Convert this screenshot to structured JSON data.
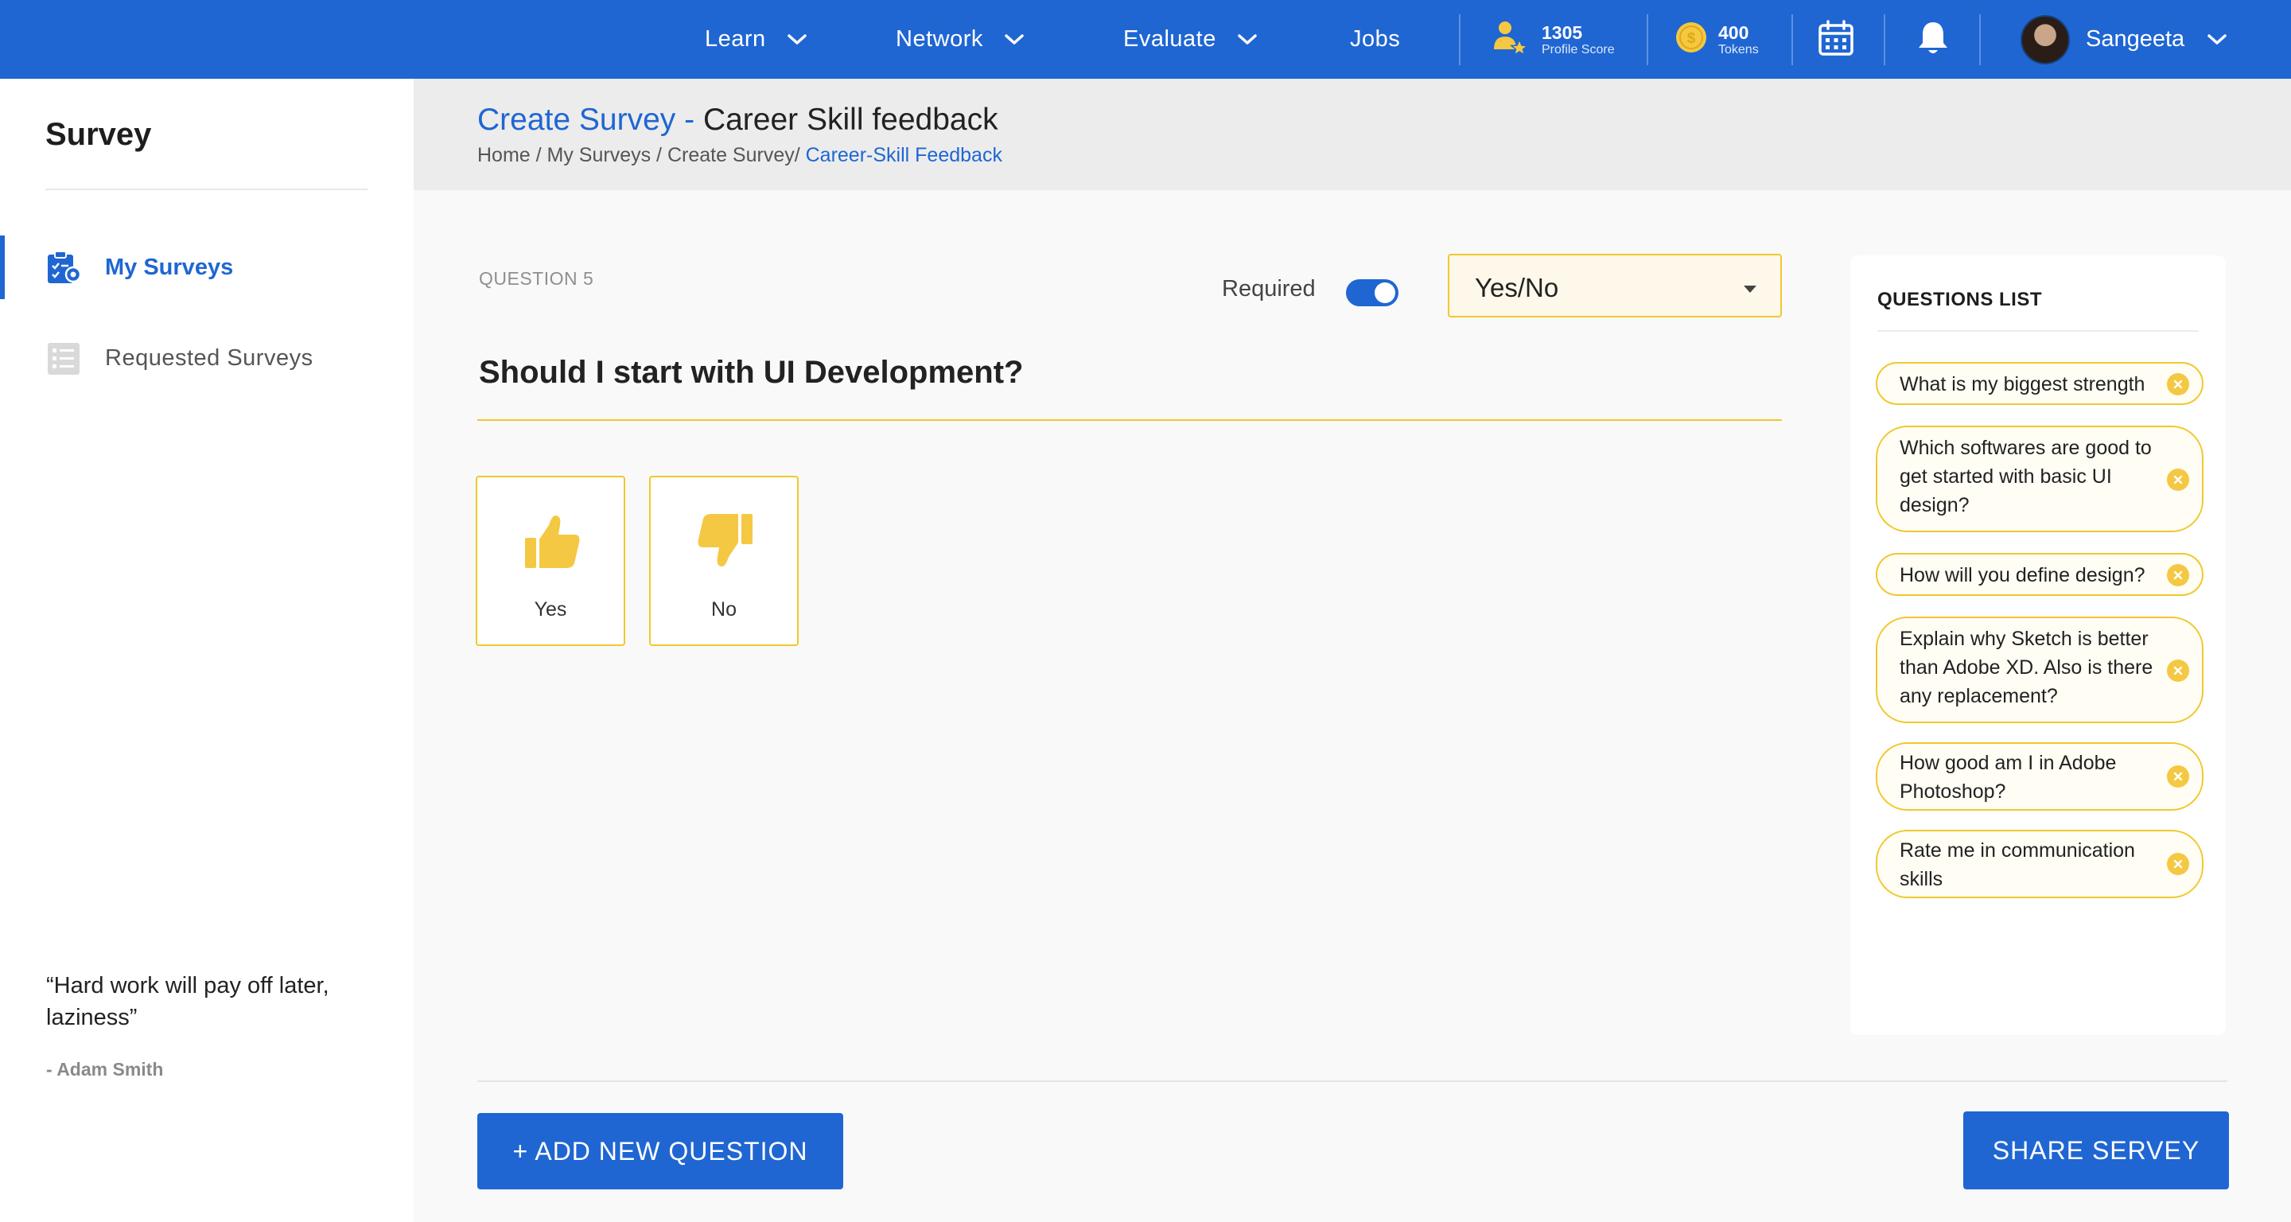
{
  "colors": {
    "primary": "#1f66d3",
    "accent": "#f1c82f",
    "accent_fill": "#f4c842",
    "band": "#ececec"
  },
  "nav": {
    "items": [
      {
        "label": "Learn",
        "icon": "chevron-down-icon"
      },
      {
        "label": "Network",
        "icon": "chevron-down-icon"
      },
      {
        "label": "Evaluate",
        "icon": "chevron-down-icon"
      },
      {
        "label": "Jobs"
      }
    ],
    "profile_score": {
      "value": "1305",
      "label": "Profile Score",
      "icon": "profile-score-icon"
    },
    "tokens": {
      "value": "400",
      "label": "Tokens",
      "icon": "coin-icon"
    },
    "calendar_icon": "calendar-icon",
    "notification_icon": "bell-icon",
    "user": {
      "name": "Sangeeta"
    }
  },
  "sidebar": {
    "title": "Survey",
    "items": [
      {
        "label": "My Surveys",
        "icon": "survey-clipboard-icon",
        "active": true
      },
      {
        "label": "Requested Surveys",
        "icon": "checklist-icon",
        "active": false
      }
    ],
    "quote": "“Hard work will pay off later, laziness”",
    "author": "- Adam Smith"
  },
  "header": {
    "title_link": "Create Survey",
    "title_sep": " - ",
    "title_rest": "Career Skill feedback",
    "breadcrumb_trail": "Home / My Surveys / Create Survey/ ",
    "breadcrumb_current": "Career-Skill Feedback"
  },
  "editor": {
    "question_label": "QUESTION 5",
    "required_label": "Required",
    "required": true,
    "question_type": "Yes/No",
    "question_text": "Should I start with UI Development?",
    "options": [
      {
        "label": "Yes",
        "icon": "thumbs-up-icon"
      },
      {
        "label": "No",
        "icon": "thumbs-down-icon"
      }
    ]
  },
  "questions_list": {
    "title": "QUESTIONS LIST",
    "items": [
      "What is my biggest strength",
      "Which softwares are good to get started with basic UI design?",
      "How will you define design?",
      "Explain why Sketch is better than Adobe XD. Also is there any replacement?",
      "How good am I in Adobe Photoshop?",
      "Rate me in communication skills"
    ]
  },
  "footer": {
    "add_label": "+ ADD NEW QUESTION",
    "share_label": "SHARE SERVEY"
  }
}
